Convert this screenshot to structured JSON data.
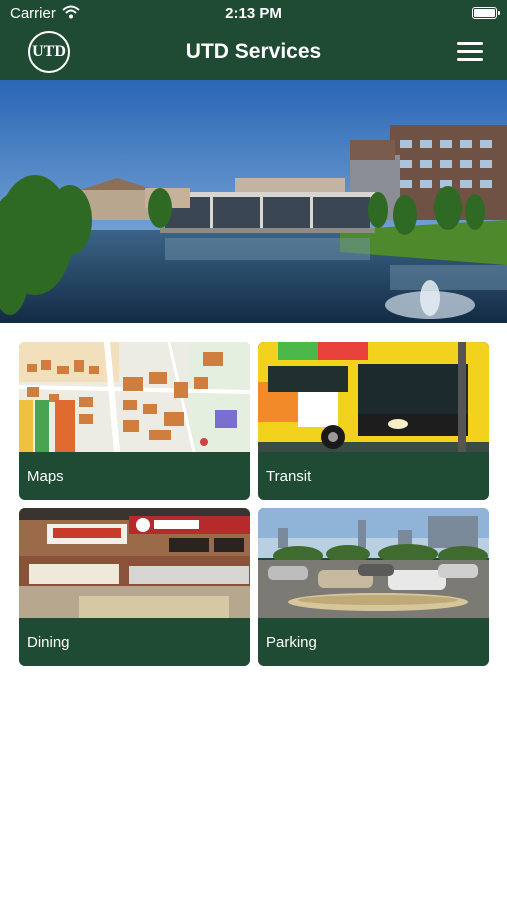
{
  "status": {
    "carrier": "Carrier",
    "time": "2:13 PM"
  },
  "header": {
    "logo_text": "UTD",
    "title": "UTD Services"
  },
  "hero": {
    "alt": "Campus lake and buildings"
  },
  "tiles": [
    {
      "label": "Maps"
    },
    {
      "label": "Transit"
    },
    {
      "label": "Dining"
    },
    {
      "label": "Parking"
    }
  ],
  "icons": [
    "wifi-icon",
    "battery-icon",
    "hamburger-menu-icon",
    "utd-logo-icon"
  ],
  "colors": {
    "header": "#1f4a33",
    "tile": "#1f4a33",
    "background": "#ffffff"
  }
}
